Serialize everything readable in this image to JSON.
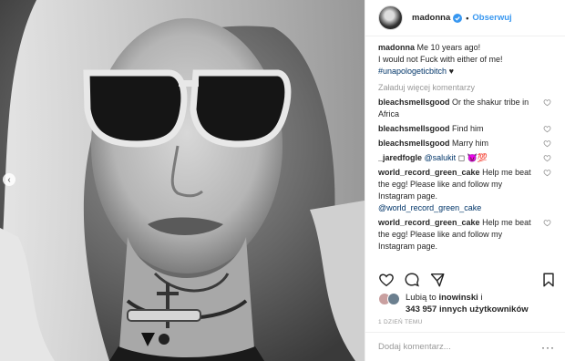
{
  "post": {
    "username": "madonna",
    "separator": "•",
    "follow_label": "Obserwuj",
    "caption_user": "madonna",
    "caption_text": "Me 10 years ago!",
    "caption_line2": "I would not Fuck with either of me!",
    "caption_tag": "#unapologeticbitch",
    "caption_tail": "♥",
    "load_more": "Załaduj więcej komentarzy",
    "comments": [
      {
        "user": "bleachsmellsgood",
        "text": "Or the shakur tribe in Africa"
      },
      {
        "user": "bleachsmellsgood",
        "text": "Find him"
      },
      {
        "user": "bleachsmellsgood",
        "text": "Marry him"
      },
      {
        "user": "_jaredfogle",
        "text": "",
        "mention": "@salukit",
        "emoji": "◻ 😈💯"
      },
      {
        "user": "world_record_green_cake",
        "text": "Help me beat the egg! Please like and follow my Instagram page.",
        "mention": "@world_record_green_cake"
      },
      {
        "user": "world_record_green_cake",
        "text": "Help me beat the egg! Please like and follow my Instagram page."
      }
    ],
    "likes_prefix": "Lubią to",
    "likes_user": "inowinski",
    "likes_and": "i",
    "likes_count": "343 957",
    "likes_suffix": "innych użytkowników",
    "timestamp": "1 DZIEŃ TEMU",
    "comment_placeholder": "Dodaj komentarz...",
    "more_options": "···"
  },
  "colors": {
    "accent": "#3897f0",
    "text": "#262626",
    "muted": "#999999",
    "link": "#003569"
  },
  "icons": {
    "verified": "verified-badge-icon",
    "like": "heart-icon",
    "comment": "comment-bubble-icon",
    "share": "share-arrow-icon",
    "save": "bookmark-icon",
    "prev": "chevron-left-icon"
  }
}
